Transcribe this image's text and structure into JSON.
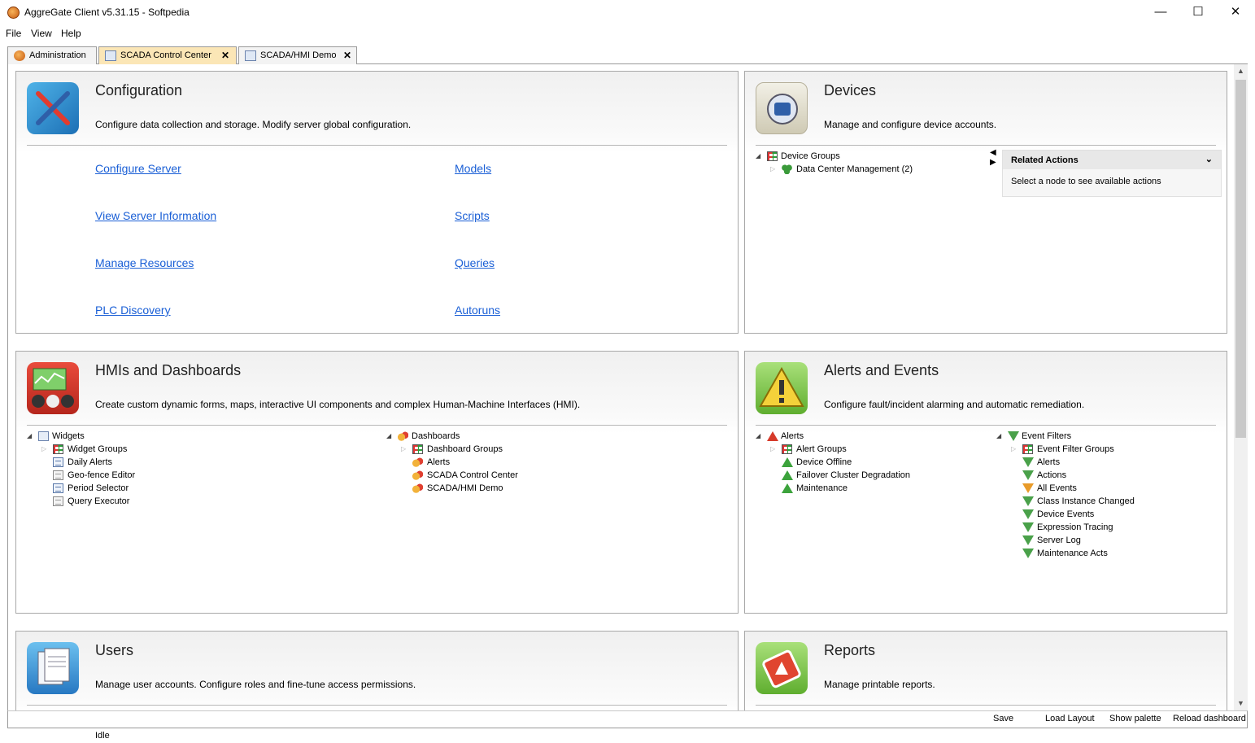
{
  "window": {
    "title": "AggreGate Client v5.31.15 - Softpedia",
    "minimize": "—",
    "maximize": "☐",
    "close": "✕"
  },
  "menu": [
    "File",
    "View",
    "Help"
  ],
  "tabs": [
    {
      "label": "Administration",
      "closable": false
    },
    {
      "label": "SCADA Control Center",
      "closable": true,
      "active": true
    },
    {
      "label": "SCADA/HMI Demo",
      "closable": true
    }
  ],
  "close_glyph": "✕",
  "configuration": {
    "title": "Configuration",
    "description": "Configure data collection and storage. Modify server global configuration.",
    "links": [
      "Configure Server",
      "View Server Information",
      "Manage Resources",
      "PLC Discovery",
      "Models",
      "Scripts",
      "Queries",
      "Autoruns"
    ]
  },
  "devices": {
    "title": "Devices",
    "description": "Manage and configure device accounts.",
    "tree": [
      {
        "label": "Device Groups",
        "icon": "grid-icon",
        "expanded": true
      },
      {
        "label": "Data Center Management (2)",
        "icon": "device-cluster-icon"
      }
    ],
    "related_actions": {
      "title": "Related Actions",
      "body": "Select a node to see available actions"
    }
  },
  "hmis": {
    "title": "HMIs and Dashboards",
    "description": "Create custom dynamic forms, maps, interactive UI components and complex Human-Machine Interfaces (HMI).",
    "widgets": {
      "root": "Widgets",
      "items": [
        "Widget Groups",
        "Daily Alerts",
        "Geo-fence Editor",
        "Period Selector",
        "Query Executor"
      ]
    },
    "dashboards": {
      "root": "Dashboards",
      "items": [
        "Dashboard Groups",
        "Alerts",
        "SCADA Control Center",
        "SCADA/HMI Demo"
      ]
    }
  },
  "alerts": {
    "title": "Alerts and Events",
    "description": "Configure fault/incident alarming and automatic remediation.",
    "alerts_tree": {
      "root": "Alerts",
      "items": [
        "Alert Groups",
        "Device Offline",
        "Failover Cluster Degradation",
        "Maintenance"
      ]
    },
    "filters_tree": {
      "root": "Event Filters",
      "items": [
        "Event Filter Groups",
        "Alerts",
        "Actions",
        "All Events",
        "Class Instance Changed",
        "Device Events",
        "Expression Tracing",
        "Server Log",
        "Maintenance Acts"
      ]
    }
  },
  "users": {
    "title": "Users",
    "description": "Manage user accounts. Configure roles and fine-tune access permissions."
  },
  "reports": {
    "title": "Reports",
    "description": "Manage printable reports."
  },
  "toolbar": {
    "save": "Save",
    "load_layout": "Load Layout",
    "show_palette": "Show palette",
    "reload_dashboard": "Reload dashboard"
  },
  "status": {
    "text": "Idle"
  }
}
